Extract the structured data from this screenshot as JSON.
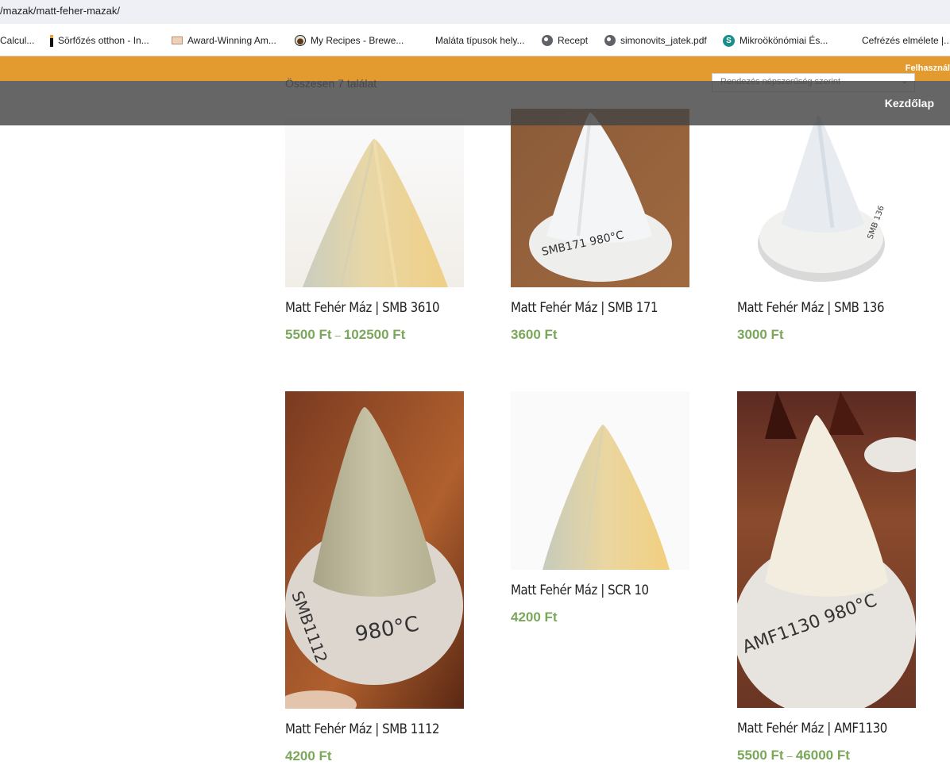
{
  "browser": {
    "url": "/mazak/matt-feher-mazak/",
    "bookmarks": [
      {
        "label": "Calcul...",
        "icon": "none"
      },
      {
        "label": "Sörfőzés otthon - In...",
        "icon": "bookmark-bar-icon"
      },
      {
        "label": "Award-Winning Am...",
        "icon": "award-icon"
      },
      {
        "label": "My Recipes - Brewe...",
        "icon": "cup-icon"
      },
      {
        "label": "Maláta típusok hely...",
        "icon": "none"
      },
      {
        "label": "Recept",
        "icon": "globe-icon"
      },
      {
        "label": "simonovits_jatek.pdf",
        "icon": "globe-icon"
      },
      {
        "label": "Mikroökönómiai És...",
        "icon": "s-icon"
      },
      {
        "label": "Cefrézés elmélete |...",
        "icon": "none"
      }
    ]
  },
  "header": {
    "user_link": "Felhasznál",
    "home_link": "Kezdőlap"
  },
  "shop": {
    "results_count": "Összesen 7 találat",
    "sort_label": "Rendezés népszerűség szerint"
  },
  "products": [
    {
      "title": "Matt Fehér Máz | SMB 3610",
      "price_from": "5500 Ft",
      "price_to": "102500 Ft"
    },
    {
      "title": "Matt Fehér Máz | SMB 171",
      "price_from": "3600 Ft",
      "price_to": ""
    },
    {
      "title": "Matt Fehér Máz | SMB 136",
      "price_from": "3000 Ft",
      "price_to": ""
    },
    {
      "title": "Matt Fehér Máz | SMB 1112",
      "price_from": "4200 Ft",
      "price_to": ""
    },
    {
      "title": "Matt Fehér Máz | SCR 10",
      "price_from": "4200 Ft",
      "price_to": ""
    },
    {
      "title": "Matt Fehér Máz | AMF1130",
      "price_from": "5500 Ft",
      "price_to": "46000 Ft"
    }
  ],
  "colors": {
    "accent": "#e39b30",
    "price": "#7aa75a"
  }
}
